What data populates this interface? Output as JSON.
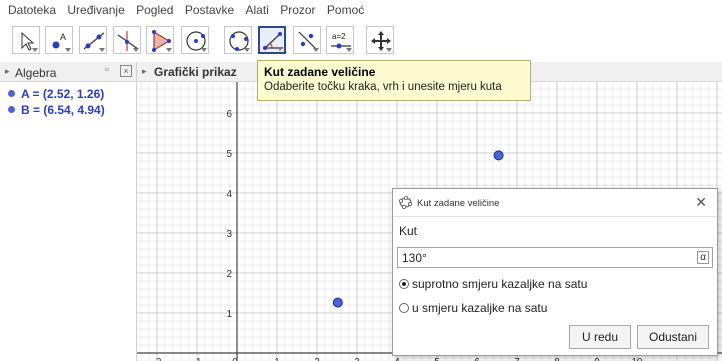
{
  "menu": [
    "Datoteka",
    "Uređivanje",
    "Pogled",
    "Postavke",
    "Alati",
    "Prozor",
    "Pomoć"
  ],
  "toolbar": {
    "tools": [
      "move-tool",
      "point-tool",
      "line-tool",
      "perpendicular-tool",
      "polygon-tool",
      "circle-tool",
      "circle-three-points-tool",
      "angle-tool",
      "reflect-tool",
      "slider-tool",
      "move-graphics-tool"
    ],
    "slider_icon_text": "a=2"
  },
  "algebra": {
    "title": "Algebra",
    "items": [
      {
        "label": "A = (2.52, 1.26)",
        "color": "#4b62d8"
      },
      {
        "label": "B = (6.54, 4.94)",
        "color": "#4b62d8"
      }
    ]
  },
  "graphics": {
    "title": "Grafički prikaz",
    "x_ticks": [
      "-2",
      "-1",
      "0",
      "1",
      "2",
      "3",
      "4",
      "5",
      "6",
      "7",
      "8",
      "9",
      "10"
    ],
    "y_ticks": [
      "1",
      "2",
      "3",
      "4",
      "5",
      "6"
    ],
    "points": [
      {
        "name": "A",
        "x": 2.52,
        "y": 1.26
      },
      {
        "name": "B",
        "x": 6.54,
        "y": 4.94
      }
    ],
    "point_color": "#4b62d8"
  },
  "tooltip": {
    "title": "Kut zadane veličine",
    "text": "Odaberite točku kraka, vrh i unesite mjeru kuta"
  },
  "dialog": {
    "title": "Kut zadane veličine",
    "label": "Kut",
    "value": "130°",
    "alpha_button": "α",
    "radio_ccw": "suprotno smjeru kazaljke na satu",
    "radio_cw": "u smjeru kazaljke na satu",
    "selected": "ccw",
    "ok": "U redu",
    "cancel": "Odustani"
  }
}
